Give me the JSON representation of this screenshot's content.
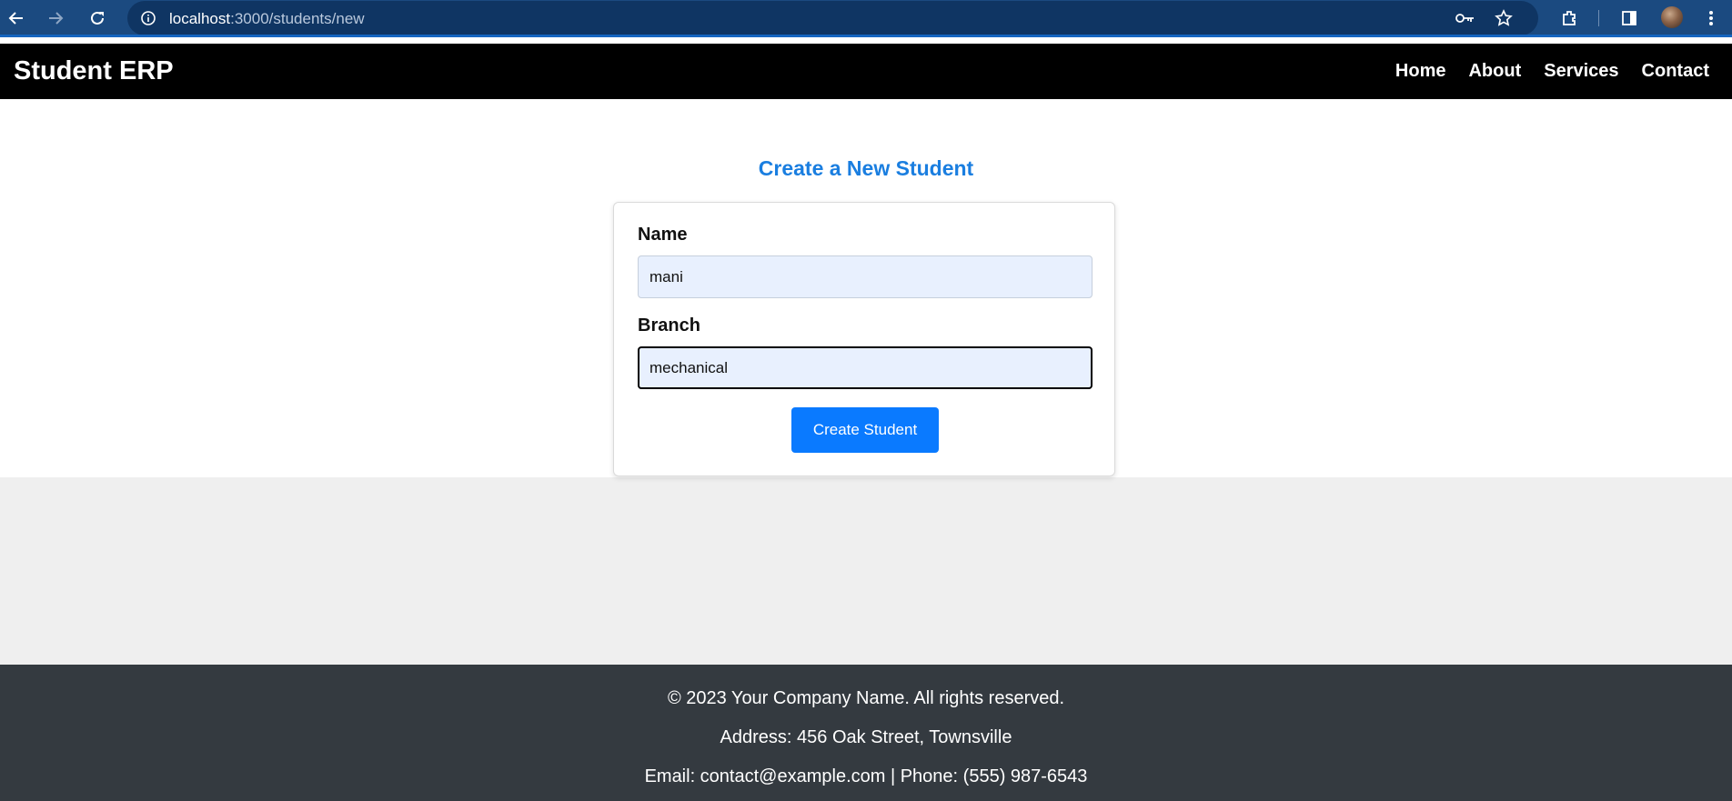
{
  "browser": {
    "url_host": "localhost",
    "url_path": ":3000/students/new"
  },
  "header": {
    "brand": "Student ERP",
    "nav": [
      "Home",
      "About",
      "Services",
      "Contact"
    ]
  },
  "form": {
    "title": "Create a New Student",
    "name_label": "Name",
    "name_value": "mani",
    "branch_label": "Branch",
    "branch_value": "mechanical",
    "submit_label": "Create Student"
  },
  "footer": {
    "copyright": "© 2023 Your Company Name. All rights reserved.",
    "address": "Address: 456 Oak Street, Townsville",
    "contact": "Email: contact@example.com | Phone: (555) 987-6543"
  },
  "colors": {
    "accent": "#0a7aff",
    "title": "#1a7ee0",
    "header_bg": "#000000",
    "footer_bg": "#343a40",
    "input_bg": "#e8f0fe"
  },
  "icons": [
    "back-arrow-icon",
    "forward-arrow-icon",
    "reload-icon",
    "site-info-icon",
    "password-key-icon",
    "bookmark-star-icon",
    "extensions-icon",
    "side-panel-icon",
    "profile-avatar",
    "more-menu-icon"
  ]
}
